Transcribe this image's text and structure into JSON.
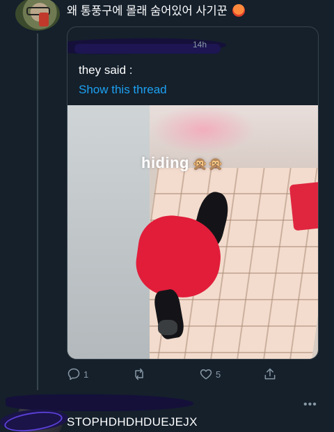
{
  "reply": {
    "text": "왜 통풍구에 몰래 숨어있어 사기꾼",
    "emoji": "angry-face"
  },
  "quote": {
    "time": "14h",
    "text": "they said :",
    "show_thread": "Show this thread",
    "media_caption": "hiding",
    "caption_emoji": "🙊🙊"
  },
  "actions": {
    "reply_count": "1",
    "retweet_count": "",
    "like_count": "5"
  },
  "next_tweet": {
    "text": "STOPHDHDHDUEJEJX",
    "more": "•••"
  },
  "colors": {
    "background": "#15202b",
    "link": "#1da1f2",
    "muted": "#8899a6",
    "border": "#38444d"
  }
}
